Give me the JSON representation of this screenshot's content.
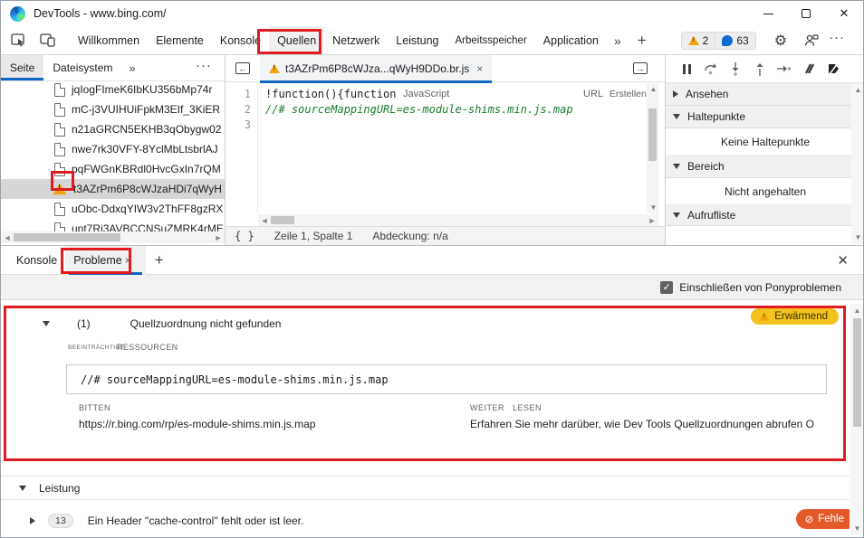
{
  "window": {
    "title": "DevTools - www.bing.com/"
  },
  "toolbar": {
    "tabs": [
      "Willkommen",
      "Elemente",
      "Konsole",
      "Quellen",
      "Netzwerk",
      "Leistung",
      "Arbeitsspeicher",
      "Application"
    ],
    "active_tab": "Quellen",
    "more_glyph": "»",
    "add_glyph": "+",
    "warning_count": "2",
    "chat_count": "63",
    "dots_glyph": "···",
    "gear_glyph": "⚙"
  },
  "sidebar": {
    "tabs": [
      "Seite",
      "Dateisystem"
    ],
    "more_glyph": "»",
    "dots_glyph": "···",
    "files": [
      "jqIogFImeK6IbKU356bMp74r",
      "mC-j3VUIHUiFpkM3EIf_3KiER",
      "n21aGRCN5EKHB3qObygw02",
      "nwe7rk30VFY-8YclMbLtsbrlAJ",
      "pqFWGnKBRdl0HvcGxIn7rQM",
      "t3AZrPm6P8cWJzaHDi7qWyH",
      "uObc-DdxqYIW3v2ThFF8gzRX",
      "upt7Ri3AVBCCNSuZMRK4rME"
    ],
    "selected_index": 5
  },
  "editor": {
    "tab_label": "t3AZrPm6P8cWJza...qWyH9DDo.br.js",
    "tab_close": "×",
    "line_numbers": [
      "1",
      "2",
      "3"
    ],
    "line1_code": "!function(){function",
    "line1_hint": "JavaScript",
    "line1_col_url": "URL",
    "line1_col_created": "Erstellen von A",
    "line2_code": "//# sourceMappingURL=es-module-shims.min.js.map",
    "status": {
      "braces": "{ }",
      "position": "Zeile 1, Spalte 1",
      "coverage": "Abdeckung: n/a"
    }
  },
  "debugger": {
    "watch_label": "Ansehen",
    "breakpoints_label": "Haltepunkte",
    "breakpoints_empty": "Keine Haltepunkte",
    "scope_label": "Bereich",
    "scope_empty": "Nicht angehalten",
    "callstack_label": "Aufrufliste"
  },
  "drawer": {
    "tabs": [
      "Konsole",
      "Probleme"
    ],
    "active_tab": "Probleme",
    "tab_close": "×",
    "add_glyph": "+",
    "close_glyph": "✕",
    "checkbox_label": "Einschließen von Ponyproblemen",
    "checkbox_check": "✓",
    "problem": {
      "count": "(1)",
      "title": "Quellzuordnung nicht gefunden",
      "badge": "Erwärmend",
      "affected_label": "BEEINTRÄCHTIGT",
      "resources_label": "RESSOURCEN",
      "code": "//# sourceMappingURL=es-module-shims.min.js.map",
      "request_label": "BITTEN",
      "request_url": "https://r.bing.com/rp/es-module-shims.min.js.map",
      "learn_label": "WEITER   LESEN",
      "learn_text": "Erfahren Sie mehr darüber, wie Dev Tools Quellzuordnungen abrufen O"
    },
    "perf_section_label": "Leistung",
    "issue": {
      "count": "13",
      "text": "Ein Header \"cache-control\" fehlt oder ist leer.",
      "badge": "Fehle",
      "badge_icon": "⊘"
    }
  }
}
